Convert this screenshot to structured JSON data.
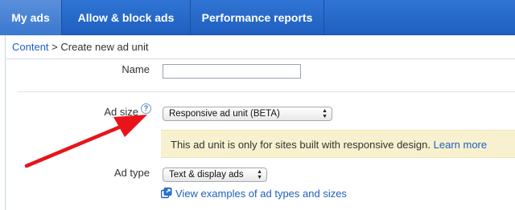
{
  "tabs": [
    {
      "label": "My ads",
      "active": true
    },
    {
      "label": "Allow & block ads",
      "active": false
    },
    {
      "label": "Performance reports",
      "active": false
    }
  ],
  "breadcrumb": {
    "link": "Content",
    "separator": " > ",
    "current": "Create new ad unit"
  },
  "form": {
    "name_label": "Name",
    "name_value": "",
    "ad_size_label": "Ad size",
    "ad_size_help_icon": "?",
    "ad_size_value": "Responsive ad unit (BETA)",
    "notice_text": "This ad unit is only for sites built with responsive design.",
    "notice_link": "Learn more",
    "ad_type_label": "Ad type",
    "ad_type_value": "Text & display ads",
    "examples_link": "View examples of ad types and sizes"
  },
  "colors": {
    "tab_bar": "#1f5fbf",
    "link": "#1f5fbf",
    "notice_background": "#f8f1cf",
    "arrow": "#e8141a"
  },
  "icons": {
    "help": "question-mark-icon",
    "examples": "popup-window-icon",
    "annotation": "red-arrow"
  }
}
